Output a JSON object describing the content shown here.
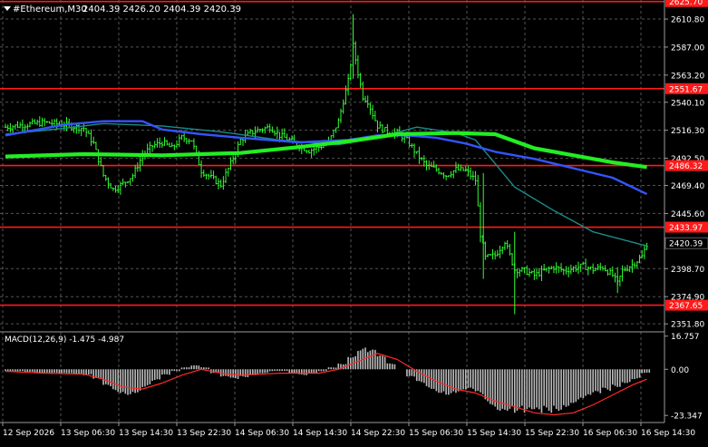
{
  "header": {
    "symbol": "#Ethereum,M30",
    "ohlc": "2404.39 2426.20 2404.39 2420.39"
  },
  "colors": {
    "background": "#000000",
    "grid": "#9a9a9a",
    "candles": "#33ff33",
    "ma_fast": "#1d8a8a",
    "ma_mid": "#3355ff",
    "ma_slow": "#22ee22",
    "level_lines": "#ff1a1a",
    "price_label_bg": "#ff1a1a",
    "current_price_bg": "#000000",
    "macd_hist": "#bbbbbb",
    "macd_signal": "#ff2a2a",
    "text": "#ffffff"
  },
  "chart_data": {
    "type": "candlestick",
    "title": "#Ethereum,M30",
    "price_axis_ticks": [
      "2610.80",
      "2587.00",
      "2563.20",
      "2540.10",
      "2516.30",
      "2492.50",
      "2469.40",
      "2445.60",
      "2398.70",
      "2374.90",
      "2351.80"
    ],
    "ylim": [
      2345,
      2627
    ],
    "levels": [
      {
        "value": 2625.7,
        "label": "2625.70"
      },
      {
        "value": 2551.67,
        "label": "2551.67"
      },
      {
        "value": 2486.32,
        "label": "2486.32"
      },
      {
        "value": 2433.97,
        "label": "2433.97"
      },
      {
        "value": 2367.65,
        "label": "2367.65"
      }
    ],
    "current_price": {
      "value": 2420.39,
      "label": "2420.39"
    },
    "time_axis_labels": [
      "12 Sep 2026",
      "13 Sep 06:30",
      "13 Sep 14:30",
      "13 Sep 22:30",
      "14 Sep 06:30",
      "14 Sep 14:30",
      "14 Sep 22:30",
      "15 Sep 06:30",
      "15 Sep 14:30",
      "15 Sep 22:30",
      "16 Sep 06:30",
      "16 Sep 14:30"
    ],
    "close_path": [
      [
        0,
        2519
      ],
      [
        2,
        2521
      ],
      [
        4,
        2523
      ],
      [
        6,
        2521
      ],
      [
        8,
        2518
      ],
      [
        9,
        2505
      ],
      [
        10,
        2478
      ],
      [
        11,
        2466
      ],
      [
        12,
        2471
      ],
      [
        13,
        2478
      ],
      [
        14,
        2495
      ],
      [
        15,
        2503
      ],
      [
        16,
        2506
      ],
      [
        17,
        2501
      ],
      [
        18,
        2510
      ],
      [
        19,
        2508
      ],
      [
        20,
        2482
      ],
      [
        21,
        2476
      ],
      [
        22,
        2470
      ],
      [
        23,
        2488
      ],
      [
        24,
        2508
      ],
      [
        25,
        2514
      ],
      [
        26,
        2517
      ],
      [
        27,
        2519
      ],
      [
        28,
        2512
      ],
      [
        29,
        2508
      ],
      [
        30,
        2503
      ],
      [
        31,
        2499
      ],
      [
        32,
        2502
      ],
      [
        33,
        2506
      ],
      [
        34,
        2524
      ],
      [
        35,
        2558
      ],
      [
        35.5,
        2588
      ],
      [
        36,
        2565
      ],
      [
        36.5,
        2545
      ],
      [
        37,
        2541
      ],
      [
        37.5,
        2530
      ],
      [
        38,
        2520
      ],
      [
        39,
        2515
      ],
      [
        40,
        2514
      ],
      [
        41,
        2508
      ],
      [
        42,
        2496
      ],
      [
        43,
        2486
      ],
      [
        44,
        2483
      ],
      [
        45,
        2478
      ],
      [
        46,
        2483
      ],
      [
        47,
        2482
      ],
      [
        48,
        2474
      ],
      [
        48.5,
        2428
      ],
      [
        49,
        2408
      ],
      [
        50,
        2410
      ],
      [
        51,
        2422
      ],
      [
        52,
        2398
      ],
      [
        53,
        2397
      ],
      [
        54,
        2393
      ],
      [
        55,
        2397
      ],
      [
        56,
        2400
      ],
      [
        57,
        2397
      ],
      [
        58,
        2399
      ],
      [
        59,
        2401
      ],
      [
        60,
        2398
      ],
      [
        61,
        2400
      ],
      [
        62,
        2393
      ],
      [
        62.5,
        2386
      ],
      [
        63,
        2397
      ],
      [
        64,
        2402
      ],
      [
        65,
        2409
      ],
      [
        65.5,
        2420
      ]
    ],
    "series": [
      {
        "name": "",
        "values": [
          [
            0,
            2513
          ],
          [
            6,
            2518
          ],
          [
            10,
            2522
          ],
          [
            16,
            2520
          ],
          [
            22,
            2515
          ],
          [
            28,
            2508
          ],
          [
            34,
            2504
          ],
          [
            38,
            2510
          ],
          [
            42,
            2519
          ],
          [
            46,
            2514
          ],
          [
            48,
            2508
          ],
          [
            50,
            2488
          ],
          [
            52,
            2468
          ],
          [
            56,
            2448
          ],
          [
            60,
            2430
          ],
          [
            65.5,
            2418
          ]
        ]
      },
      {
        "name": "",
        "values": [
          [
            0,
            2512
          ],
          [
            6,
            2521
          ],
          [
            10,
            2524
          ],
          [
            14,
            2524
          ],
          [
            16,
            2517
          ],
          [
            20,
            2513
          ],
          [
            24,
            2510
          ],
          [
            30,
            2506
          ],
          [
            35,
            2508
          ],
          [
            38,
            2512
          ],
          [
            41,
            2512
          ],
          [
            44,
            2510
          ],
          [
            47,
            2505
          ],
          [
            50,
            2498
          ],
          [
            54,
            2492
          ],
          [
            58,
            2484
          ],
          [
            62,
            2476
          ],
          [
            65.5,
            2462
          ]
        ]
      },
      {
        "name": "",
        "values": [
          [
            0,
            2494
          ],
          [
            8,
            2496
          ],
          [
            16,
            2495
          ],
          [
            24,
            2497
          ],
          [
            30,
            2502
          ],
          [
            36,
            2508
          ],
          [
            40,
            2513
          ],
          [
            46,
            2514
          ],
          [
            50,
            2513
          ],
          [
            54,
            2501
          ],
          [
            58,
            2495
          ],
          [
            62,
            2489
          ],
          [
            65.5,
            2485
          ]
        ]
      }
    ],
    "macd": {
      "label": "MACD(12,26,9) -1.475 -4.987",
      "ticks": [
        "16.757",
        "0.00",
        "-23.347"
      ],
      "ylim": [
        -26,
        18
      ],
      "histogram": [
        [
          0,
          -1
        ],
        [
          1,
          -1
        ],
        [
          2,
          -1.5
        ],
        [
          3,
          -2
        ],
        [
          4,
          -2
        ],
        [
          5,
          -2
        ],
        [
          6,
          -2
        ],
        [
          7,
          -2.5
        ],
        [
          8,
          -3
        ],
        [
          9,
          -5
        ],
        [
          10,
          -9
        ],
        [
          11,
          -12
        ],
        [
          12,
          -13
        ],
        [
          13,
          -12
        ],
        [
          14,
          -9
        ],
        [
          15,
          -6
        ],
        [
          16,
          -3
        ],
        [
          17,
          -1
        ],
        [
          18,
          1
        ],
        [
          19,
          2
        ],
        [
          20,
          1
        ],
        [
          21,
          -2
        ],
        [
          22,
          -4
        ],
        [
          23,
          -5
        ],
        [
          24,
          -4
        ],
        [
          25,
          -3
        ],
        [
          26,
          -2
        ],
        [
          27,
          -1
        ],
        [
          28,
          -1
        ],
        [
          29,
          -2
        ],
        [
          30,
          -3
        ],
        [
          31,
          -2
        ],
        [
          32,
          -1
        ],
        [
          33,
          1
        ],
        [
          34,
          3
        ],
        [
          35,
          7
        ],
        [
          36,
          11
        ],
        [
          37,
          10
        ],
        [
          38,
          7
        ],
        [
          39,
          3
        ],
        [
          40,
          0
        ],
        [
          41,
          -4
        ],
        [
          42,
          -7
        ],
        [
          43,
          -10
        ],
        [
          44,
          -12
        ],
        [
          45,
          -13
        ],
        [
          46,
          -12
        ],
        [
          47,
          -11
        ],
        [
          48,
          -13
        ],
        [
          49,
          -18
        ],
        [
          50,
          -21
        ],
        [
          51,
          -21
        ],
        [
          52,
          -22
        ],
        [
          53,
          -23
        ],
        [
          54,
          -23
        ],
        [
          55,
          -22
        ],
        [
          56,
          -21
        ],
        [
          57,
          -19
        ],
        [
          58,
          -17
        ],
        [
          59,
          -15
        ],
        [
          60,
          -13
        ],
        [
          61,
          -11
        ],
        [
          62,
          -9
        ],
        [
          63,
          -7
        ],
        [
          64,
          -5
        ],
        [
          65,
          -2
        ]
      ],
      "signal": [
        [
          0,
          -1
        ],
        [
          4,
          -2
        ],
        [
          8,
          -2.5
        ],
        [
          10,
          -5
        ],
        [
          12,
          -9
        ],
        [
          14,
          -10
        ],
        [
          16,
          -7
        ],
        [
          18,
          -3
        ],
        [
          20,
          0
        ],
        [
          22,
          -2
        ],
        [
          24,
          -3
        ],
        [
          28,
          -2
        ],
        [
          32,
          -2
        ],
        [
          34,
          0
        ],
        [
          36,
          4
        ],
        [
          38,
          8
        ],
        [
          40,
          5
        ],
        [
          42,
          -1
        ],
        [
          44,
          -6
        ],
        [
          46,
          -10
        ],
        [
          48,
          -12
        ],
        [
          50,
          -16
        ],
        [
          52,
          -19
        ],
        [
          54,
          -22
        ],
        [
          56,
          -23
        ],
        [
          58,
          -22
        ],
        [
          60,
          -18
        ],
        [
          62,
          -13
        ],
        [
          64,
          -8
        ],
        [
          65.5,
          -5
        ]
      ]
    }
  }
}
